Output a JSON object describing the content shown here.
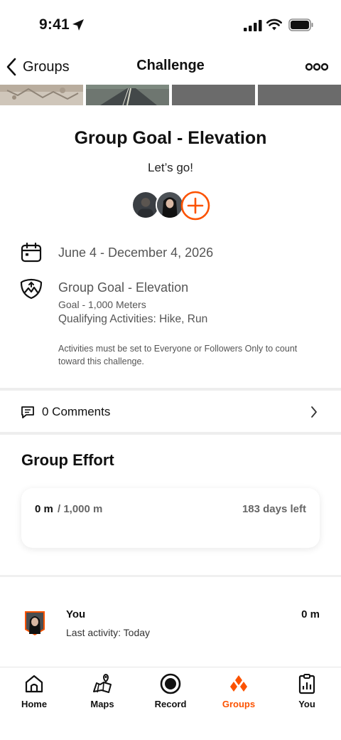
{
  "status_bar": {
    "time": "9:41"
  },
  "nav": {
    "back_label": "Groups",
    "title": "Challenge"
  },
  "challenge": {
    "title": "Group Goal - Elevation",
    "subtitle": "Let’s go!",
    "date_range": "June 4 - December 4, 2026",
    "goal_title": "Group Goal - Elevation",
    "goal_amount": "Goal - 1,000 Meters",
    "qualifying": "Qualifying Activities: Hike, Run",
    "note": "Activities must be set to Everyone or Followers Only to count toward this challenge."
  },
  "comments": {
    "label": "0 Comments"
  },
  "group_effort": {
    "title": "Group Effort",
    "current": "0 m",
    "goal": "/ 1,000 m",
    "days_left": "183 days left"
  },
  "leaderboard": [
    {
      "name": "You",
      "subtitle": "Last activity: Today",
      "value": "0 m"
    }
  ],
  "tabs": [
    {
      "label": "Home",
      "icon": "home-icon"
    },
    {
      "label": "Maps",
      "icon": "maps-icon"
    },
    {
      "label": "Record",
      "icon": "record-icon"
    },
    {
      "label": "Groups",
      "icon": "groups-icon",
      "active": true
    },
    {
      "label": "You",
      "icon": "you-icon"
    }
  ],
  "colors": {
    "accent": "#fc5200",
    "text": "#111111",
    "muted": "#555555"
  }
}
